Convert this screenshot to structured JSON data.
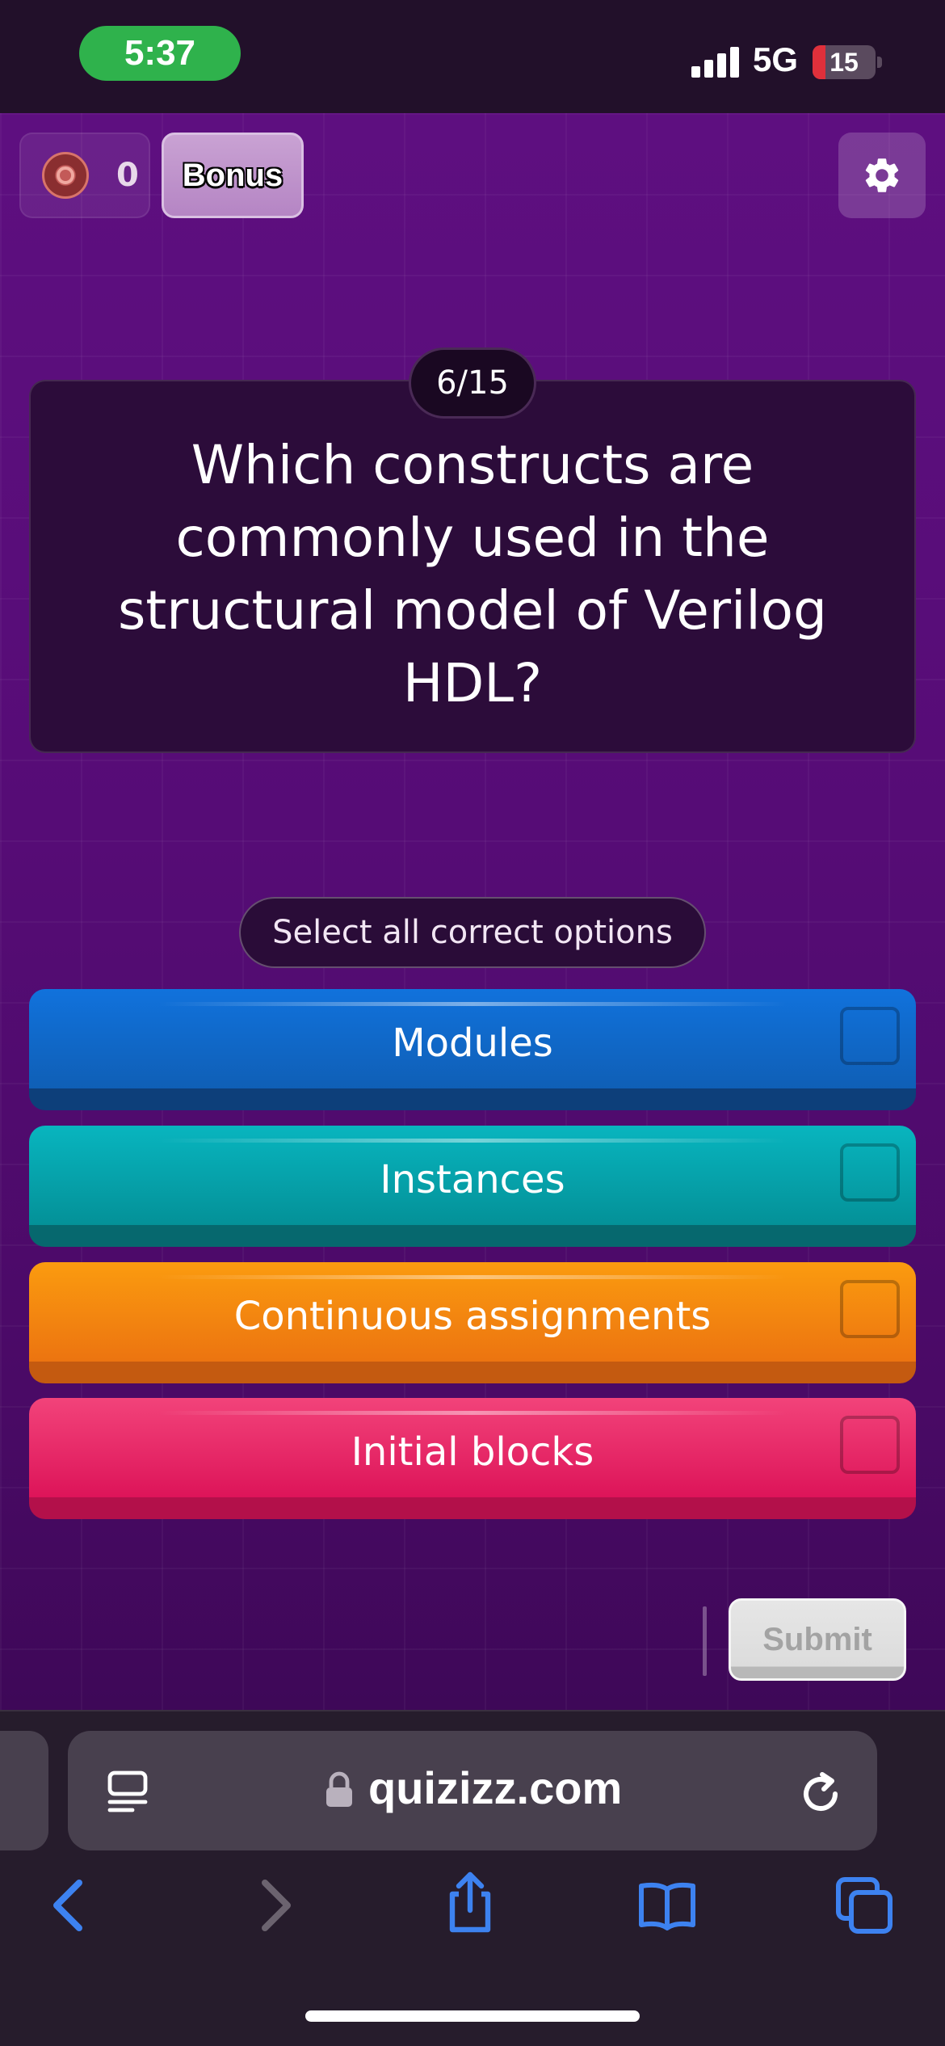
{
  "status_bar": {
    "time": "5:37",
    "network": "5G",
    "battery": "15",
    "icons": [
      "signal-icon",
      "battery-icon"
    ]
  },
  "game": {
    "score": "0",
    "bonus_label": "Bonus",
    "icons": [
      "powerup-icon",
      "gear-icon"
    ]
  },
  "question": {
    "counter": "6/15",
    "text": "Which constructs are commonly used in the structural model of Verilog HDL?"
  },
  "hint": "Select all correct options",
  "options": [
    {
      "label": "Modules",
      "color": "#1172dc",
      "checked": false
    },
    {
      "label": "Instances",
      "color": "#08b5bf",
      "checked": false
    },
    {
      "label": "Continuous assignments",
      "color": "#fb9b0f",
      "checked": false
    },
    {
      "label": "Initial blocks",
      "color": "#f2437a",
      "checked": false
    }
  ],
  "submit_label": "Submit",
  "browser": {
    "url": "quizizz.com",
    "icons": [
      "reader-icon",
      "lock-icon",
      "reload-icon",
      "back-icon",
      "forward-icon",
      "share-icon",
      "bookmarks-icon",
      "tabs-icon"
    ]
  },
  "colors": {
    "background": "#5e0f80",
    "accent_link": "#3d82f0"
  }
}
